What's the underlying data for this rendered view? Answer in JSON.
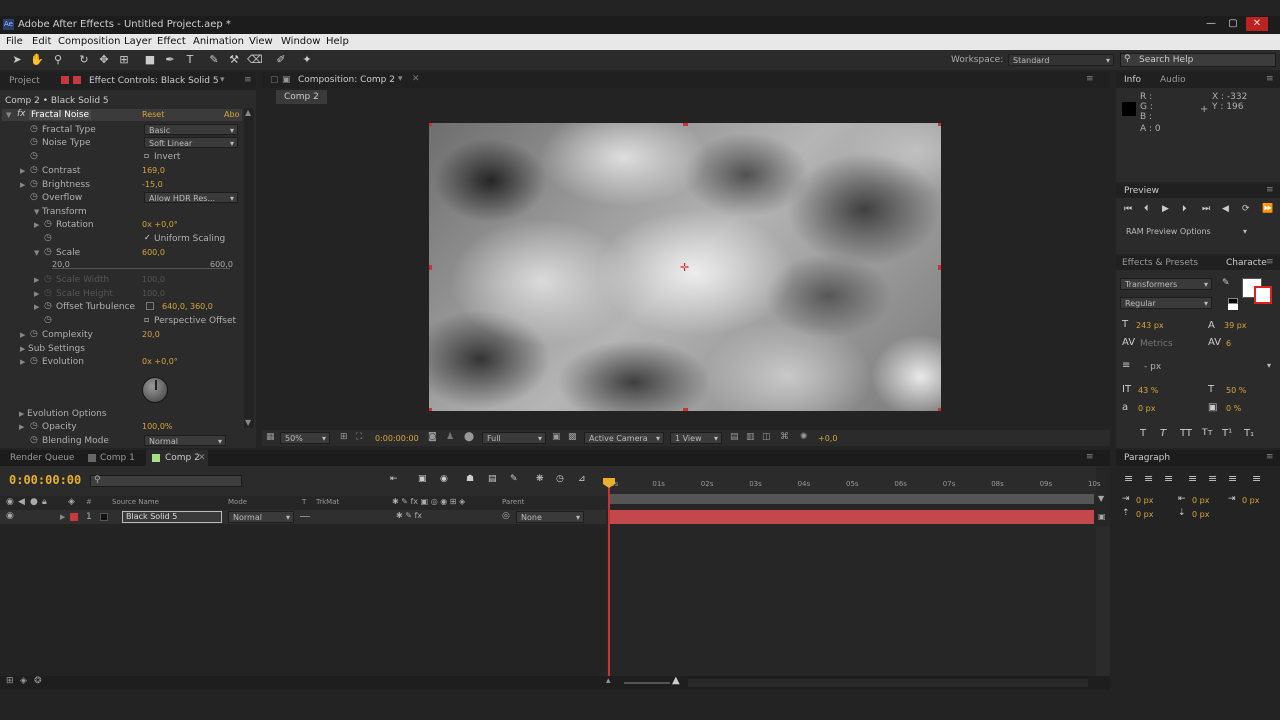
{
  "app": {
    "title": "Adobe After Effects - Untitled Project.aep *"
  },
  "menu": [
    "File",
    "Edit",
    "Composition",
    "Layer",
    "Effect",
    "Animation",
    "View",
    "Window",
    "Help"
  ],
  "workspace": {
    "label": "Workspace:",
    "value": "Standard",
    "search": "Search Help"
  },
  "effect_panel": {
    "tab_project": "Project",
    "tab_effect": "Effect Controls: Black Solid 5",
    "header": "Comp 2 • Black Solid 5",
    "effect_name": "Fractal Noise",
    "reset": "Reset",
    "about": "Abo",
    "props": [
      {
        "name": "Fractal Type",
        "type": "dd",
        "value": "Basic"
      },
      {
        "name": "Noise Type",
        "type": "dd",
        "value": "Soft Linear"
      },
      {
        "name": "",
        "type": "check",
        "value": "Invert"
      },
      {
        "name": "Contrast",
        "type": "val",
        "value": "169,0"
      },
      {
        "name": "Brightness",
        "type": "val",
        "value": "-15,0"
      },
      {
        "name": "Overflow",
        "type": "dd",
        "value": "Allow HDR Res..."
      },
      {
        "name": "Transform",
        "type": "group",
        "value": ""
      },
      {
        "name": "Rotation",
        "type": "val",
        "value": "0x +0,0°"
      },
      {
        "name": "",
        "type": "check",
        "value": "Uniform Scaling"
      },
      {
        "name": "Scale",
        "type": "val",
        "value": "600,0"
      },
      {
        "name": "",
        "type": "slider",
        "min": "20,0",
        "max": "600,0"
      },
      {
        "name": "Scale Width",
        "type": "dim",
        "value": "100,0"
      },
      {
        "name": "Scale Height",
        "type": "dim",
        "value": "100,0"
      },
      {
        "name": "Offset Turbulence",
        "type": "val",
        "value": "640,0, 360,0"
      },
      {
        "name": "",
        "type": "check",
        "value": "Perspective Offset"
      },
      {
        "name": "Complexity",
        "type": "val",
        "value": "20,0"
      },
      {
        "name": "Sub Settings",
        "type": "group",
        "value": ""
      },
      {
        "name": "Evolution",
        "type": "val",
        "value": "0x +0,0°"
      }
    ],
    "evolution_options": "Evolution Options",
    "opacity": {
      "name": "Opacity",
      "value": "100,0%"
    },
    "blending": {
      "name": "Blending Mode",
      "value": "Normal"
    }
  },
  "comp_panel": {
    "tab": "Composition: Comp 2",
    "sub": "Comp 2",
    "zoom": "50%",
    "time": "0:00:00:00",
    "quality": "Full",
    "camera": "Active Camera",
    "views": "1 View",
    "exposure": "+0,0"
  },
  "info_panel": {
    "tab_info": "Info",
    "tab_audio": "Audio",
    "r": "R :",
    "g": "G :",
    "b": "B :",
    "a": "A : 0",
    "x": "X : -332",
    "y": "Y : 196"
  },
  "preview_panel": {
    "tab": "Preview",
    "ram": "RAM Preview Options"
  },
  "char_panel": {
    "tab_effects": "Effects & Presets",
    "tab_char": "Characte",
    "font": "Transformers",
    "style": "Regular",
    "size": "243 px",
    "leading": "39 px",
    "kerning": "Metrics",
    "tracking": "6",
    "stroke": "- px",
    "vscale": "43 %",
    "hscale": "50 %",
    "baseline": "0 px",
    "tsume": "0 %"
  },
  "para_panel": {
    "tab": "Paragraph",
    "a": "0 px",
    "b": "0 px",
    "c": "0 px",
    "d": "0 px",
    "e": "0 px"
  },
  "timeline": {
    "tab_render": "Render Queue",
    "tab_comp1": "Comp 1",
    "tab_comp2": "Comp 2",
    "timecode": "0:00:00:00",
    "cols": {
      "source": "Source Name",
      "mode": "Mode",
      "t": "T",
      "trkmat": "TrkMat",
      "parent": "Parent"
    },
    "layer": {
      "num": "1",
      "name": "Black Solid 5",
      "mode": "Normal",
      "parent": "None"
    },
    "ruler": [
      "0s",
      "01s",
      "02s",
      "03s",
      "04s",
      "05s",
      "06s",
      "07s",
      "08s",
      "09s",
      "10s"
    ]
  },
  "colors": {
    "accent": "#d8a53a",
    "layer_bar": "#c4474b",
    "label_red": "#c8383d"
  }
}
